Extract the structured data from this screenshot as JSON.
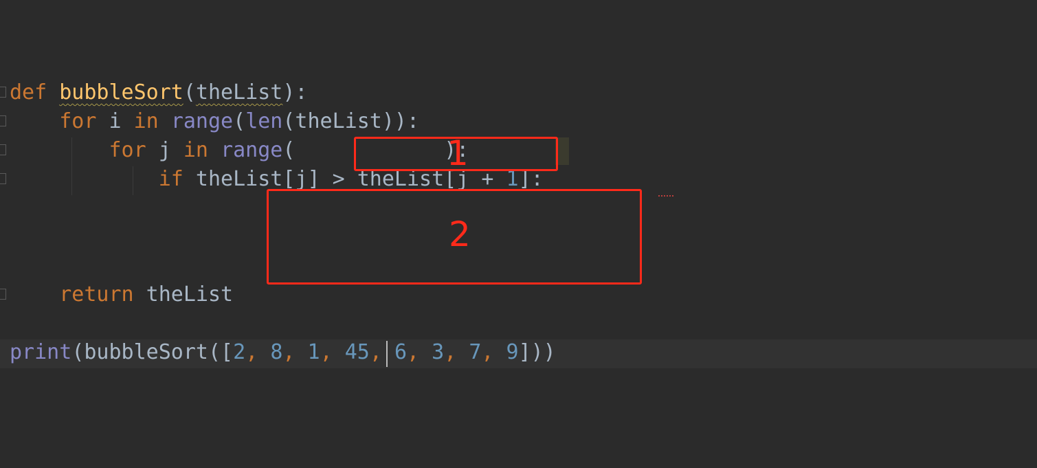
{
  "editor": {
    "lines": {
      "def_kw": "def",
      "def_name": "bubbleSort",
      "def_open": "(",
      "def_param": "theList",
      "def_close": "):",
      "for1_kw": "for",
      "for1_var": " i ",
      "for1_in": "in",
      "for1_range": "range",
      "for1_open": "(",
      "for1_len": "len",
      "for1_rest": "(theList)):",
      "for2_kw": "for",
      "for2_var": " j ",
      "for2_in": "in",
      "for2_range": "range",
      "for2_open": "(",
      "for2_close": "):",
      "if_kw": "if",
      "if_expr_a": " theList[j] > theList[j + ",
      "if_num": "1",
      "if_expr_b": "]:",
      "return_kw": "return",
      "return_val": " theList",
      "print_fn": "print",
      "print_open": "(bubbleSort([",
      "args": [
        "2",
        "8",
        "1",
        "45",
        "6",
        "3",
        "7",
        "9"
      ],
      "sep": ", ",
      "print_close": "]))"
    }
  },
  "annotations": {
    "box1_label": "1",
    "box2_label": "2",
    "color": "#ff2a1a"
  },
  "icons": [
    "fold-marker-icon"
  ]
}
